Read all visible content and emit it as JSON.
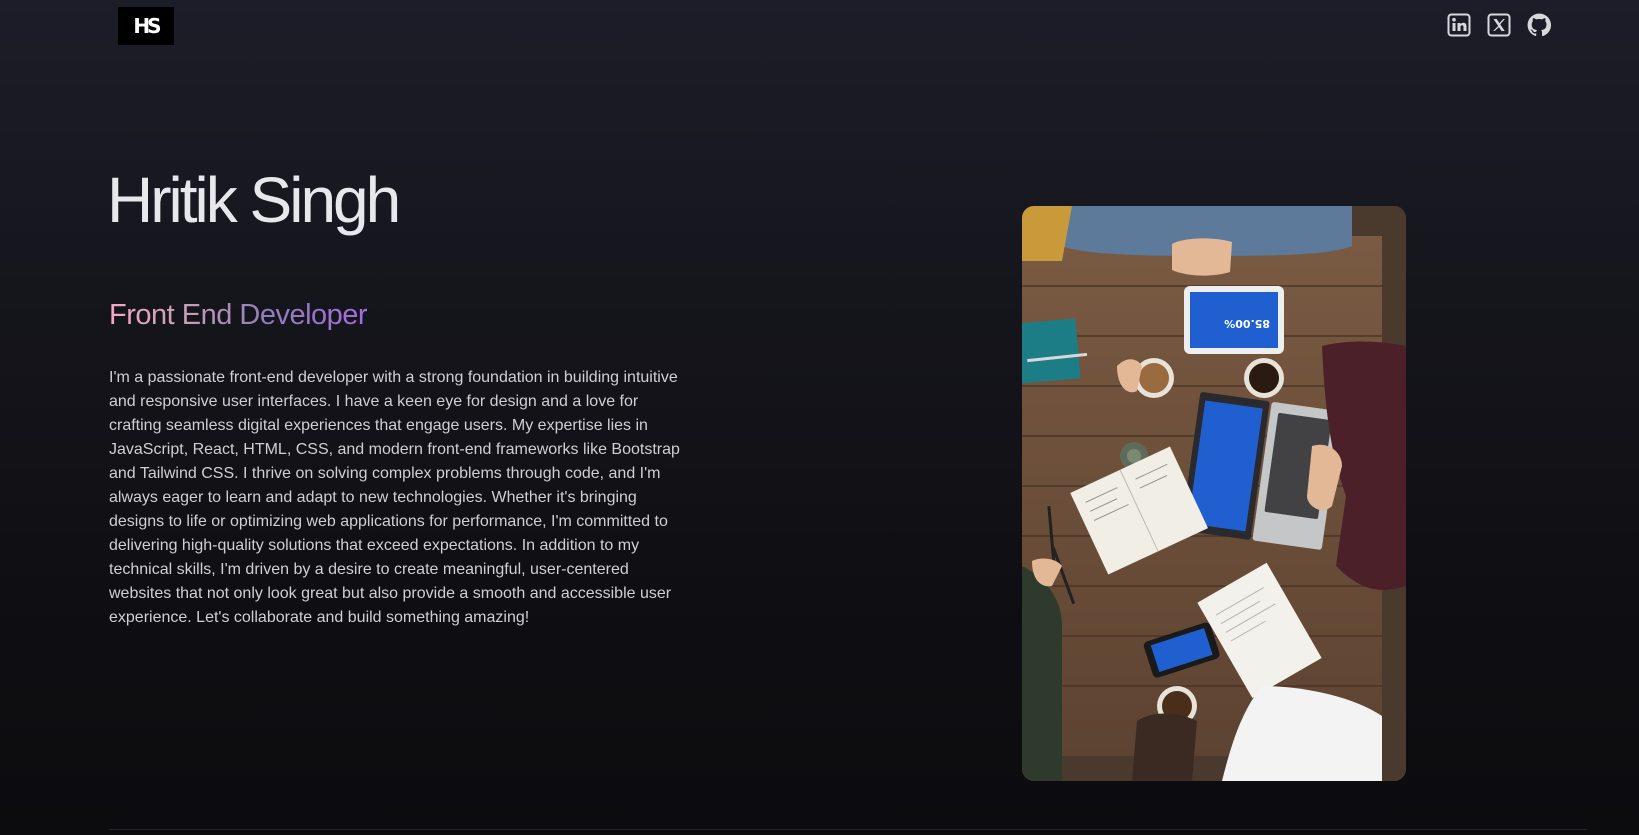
{
  "header": {
    "logo_text": "HS",
    "social_links": [
      {
        "icon": "linkedin-icon"
      },
      {
        "icon": "x-twitter-icon"
      },
      {
        "icon": "github-icon"
      }
    ]
  },
  "hero": {
    "name": "Hritik Singh",
    "role": "Front End Developer",
    "bio": "I'm a passionate front-end developer with a strong foundation in building intuitive and responsive user interfaces. I have a keen eye for design and a love for crafting seamless digital experiences that engage users. My expertise lies in JavaScript, React, HTML, CSS, and modern front-end frameworks like Bootstrap and Tailwind CSS. I thrive on solving complex problems through code, and I'm always eager to learn and adapt to new technologies. Whether it's bringing designs to life or optimizing web applications for performance, I'm committed to delivering high-quality solutions that exceed expectations. In addition to my technical skills, I'm driven by a desire to create meaningful, user-centered websites that not only look great but also provide a smooth and accessible user experience. Let's collaborate and build something amazing!",
    "photo": {
      "tablet_text": "85.00%"
    }
  },
  "colors": {
    "background": "#15151c",
    "role_gradient_start": "#f3a9c7",
    "role_gradient_end": "#a66be0"
  }
}
